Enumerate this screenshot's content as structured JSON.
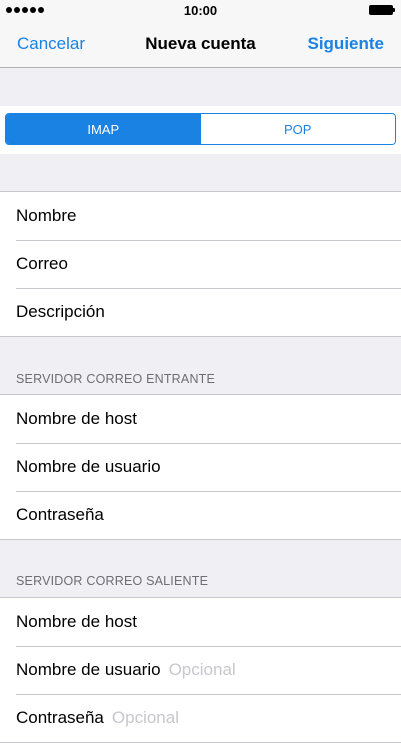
{
  "status_bar": {
    "time": "10:00"
  },
  "nav": {
    "left_label": "Cancelar",
    "title": "Nueva cuenta",
    "right_label": "Siguiente"
  },
  "segmented": {
    "options": [
      "IMAP",
      "POP"
    ],
    "selected": "IMAP"
  },
  "account": {
    "rows": [
      {
        "label": "Nombre",
        "placeholder": ""
      },
      {
        "label": "Correo",
        "placeholder": ""
      },
      {
        "label": "Descripción",
        "placeholder": ""
      }
    ]
  },
  "incoming": {
    "header": "SERVIDOR CORREO ENTRANTE",
    "rows": [
      {
        "label": "Nombre de host",
        "placeholder": ""
      },
      {
        "label": "Nombre de usuario",
        "placeholder": ""
      },
      {
        "label": "Contraseña",
        "placeholder": ""
      }
    ]
  },
  "outgoing": {
    "header": "SERVIDOR CORREO SALIENTE",
    "rows": [
      {
        "label": "Nombre de host",
        "placeholder": ""
      },
      {
        "label": "Nombre de usuario",
        "placeholder": "Opcional"
      },
      {
        "label": "Contraseña",
        "placeholder": "Opcional"
      }
    ]
  },
  "colors": {
    "accent": "#1a82e2",
    "background": "#efeff4",
    "separator": "#c8c7cc",
    "placeholder": "#c7c7cd",
    "section_header": "#6d6d72"
  }
}
